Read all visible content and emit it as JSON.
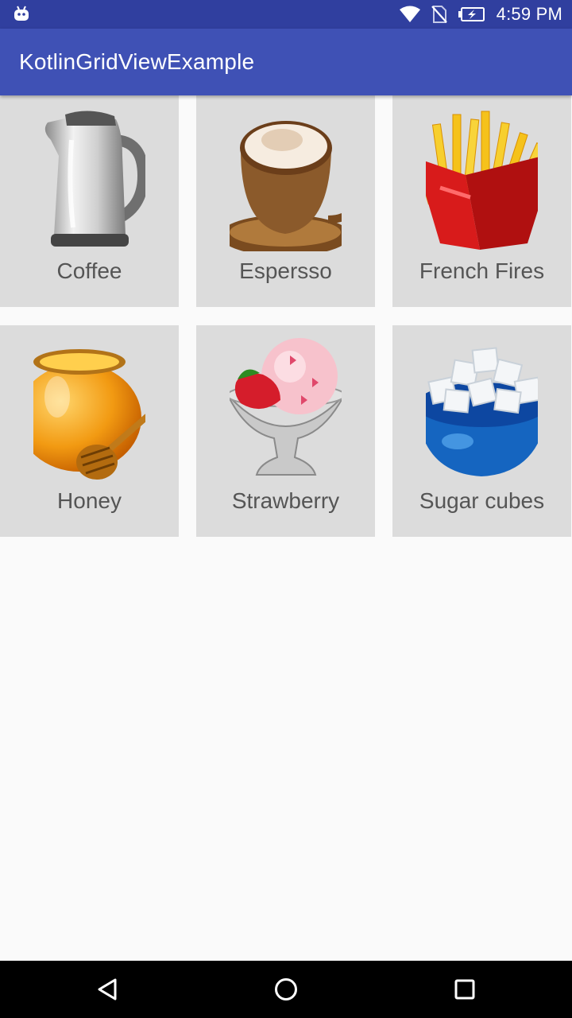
{
  "status_bar": {
    "time": "4:59 PM",
    "icons": [
      "android-debug-icon",
      "wifi-icon",
      "no-sim-icon",
      "battery-charging-icon"
    ]
  },
  "app_bar": {
    "title": "KotlinGridViewExample",
    "color": "#3f51b5",
    "status_color": "#303f9f"
  },
  "grid": {
    "items": [
      {
        "label": "Coffee",
        "icon": "kettle-icon"
      },
      {
        "label": "Espersso",
        "icon": "cappuccino-cup-icon"
      },
      {
        "label": "French Fires",
        "icon": "french-fries-icon"
      },
      {
        "label": "Honey",
        "icon": "honey-pot-icon"
      },
      {
        "label": "Strawberry",
        "icon": "ice-cream-bowl-icon"
      },
      {
        "label": "Sugar cubes",
        "icon": "sugar-bowl-icon"
      }
    ]
  },
  "nav_bar": {
    "buttons": [
      "back-icon",
      "home-icon",
      "recents-icon"
    ]
  }
}
